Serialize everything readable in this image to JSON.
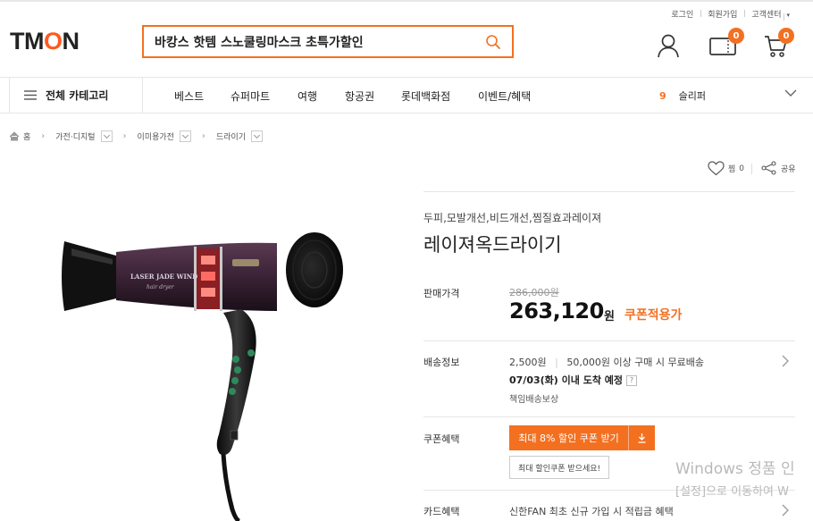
{
  "colors": {
    "accent": "#f37021",
    "text": "#222222"
  },
  "util_links": {
    "login": "로그인",
    "join": "회원가입",
    "help": "고객센터",
    "help_caret": "▾"
  },
  "logo": {
    "t1": "TM",
    "o": "O",
    "t2": "N"
  },
  "search": {
    "value": "바캉스 핫템 스노쿨링마스크 초특가할인",
    "icon": "search-icon"
  },
  "header_icons": {
    "user": "user-icon",
    "pass": "pass-icon",
    "cart": "cart-icon",
    "pass_count": "0",
    "cart_count": "0"
  },
  "nav": {
    "category_label": "전체 카테고리",
    "items": [
      "베스트",
      "슈퍼마트",
      "여행",
      "항공권",
      "롯데백화점",
      "이벤트/혜택"
    ],
    "rank_number": "9",
    "rank_keyword": "슬리퍼"
  },
  "breadcrumb": [
    "홈",
    "가전·디지털",
    "이미용가전",
    "드라이기"
  ],
  "actions": {
    "wish_label": "찜",
    "wish_count": "0",
    "share_label": "공유"
  },
  "product": {
    "subtitle": "두피,모발개선,비드개선,찜질효과레이져",
    "title": "레이져옥드라이기",
    "image_text": {
      "brand": "LASER JADE WIND",
      "sub": "hair dryer"
    },
    "price_label": "판매가격",
    "original_price": "286,000원",
    "price": "263,120",
    "currency": "원",
    "coupon_price_label": "쿠폰적용가",
    "shipping_label": "배송정보",
    "shipping_fee": "2,500원",
    "shipping_free": "50,000원 이상 구매 시 무료배송",
    "arrival": "07/03(화) 이내 도착 예정",
    "arrival_help": "?",
    "shipping_guarantee": "책임배송보상",
    "coupon_label": "쿠폰혜택",
    "coupon_button": "최대 8% 할인 쿠폰 받기",
    "coupon_tip": "최대 할인쿠폰 받으세요!",
    "card_label": "카드혜택",
    "card_benefit": "신한FAN 최초 신규 가입 시 적립금 혜택"
  },
  "watermark": {
    "line1": "Windows 정품 인",
    "line2": "[설정]으로 이동하여 W"
  }
}
